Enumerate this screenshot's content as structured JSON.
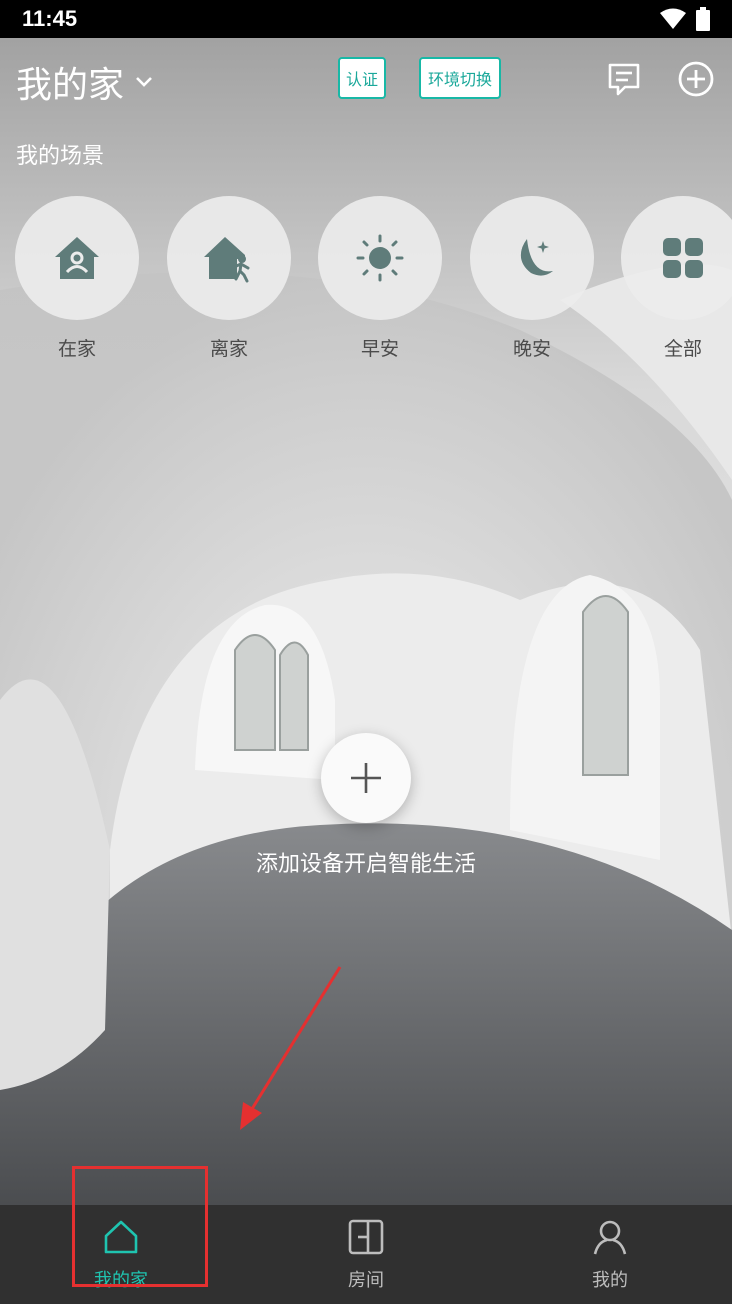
{
  "status_bar": {
    "time": "11:45"
  },
  "header": {
    "home_name": "我的家",
    "auth_label": "认证",
    "env_switch_label": "环境切换"
  },
  "scenes": {
    "section_title": "我的场景",
    "items": [
      {
        "label": "在家",
        "icon": "home-person-icon"
      },
      {
        "label": "离家",
        "icon": "leave-home-icon"
      },
      {
        "label": "早安",
        "icon": "sun-icon"
      },
      {
        "label": "晚安",
        "icon": "moon-icon"
      },
      {
        "label": "全部",
        "icon": "grid-icon"
      }
    ]
  },
  "empty_state": {
    "add_device_text": "添加设备开启智能生活"
  },
  "bottom_nav": {
    "items": [
      {
        "label": "我的家",
        "icon": "home-icon",
        "active": true
      },
      {
        "label": "房间",
        "icon": "room-icon",
        "active": false
      },
      {
        "label": "我的",
        "icon": "profile-icon",
        "active": false
      }
    ]
  },
  "colors": {
    "accent": "#1fc4b0",
    "icon_teal_gray": "#5f7c7a",
    "annotation_red": "#e53030",
    "nav_bg": "#303030"
  }
}
